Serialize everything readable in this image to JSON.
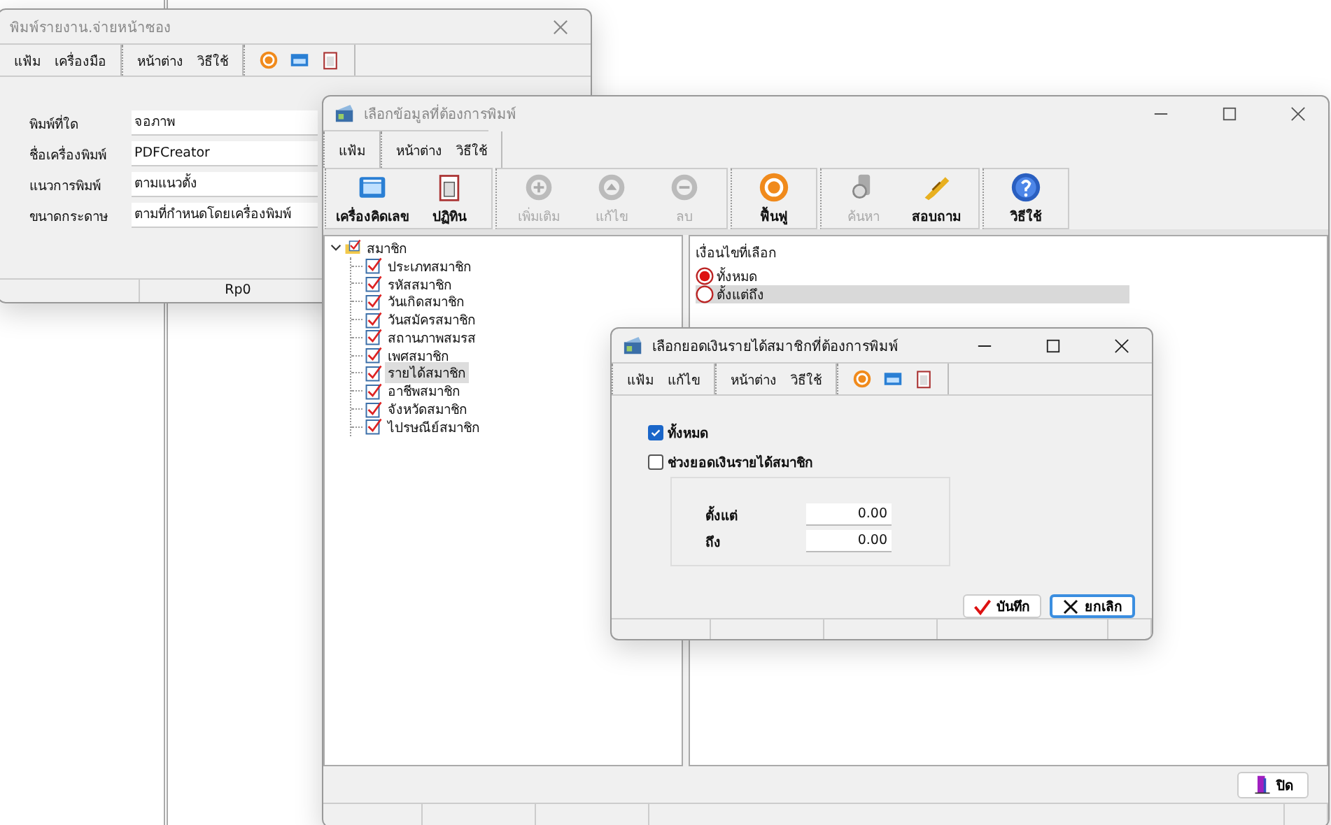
{
  "print_window": {
    "title": "พิมพ์รายงาน.จ่ายหน้าซอง",
    "active": false,
    "menu": [
      [
        "แฟ้ม",
        "เครื่องมือ"
      ],
      [
        "หน้าต่าง",
        "วิธีใช้"
      ]
    ],
    "fields": [
      {
        "label": "พิมพ์ที่ใด",
        "value": "จอภาพ"
      },
      {
        "label": "ชื่อเครื่องพิมพ์",
        "value": "PDFCreator"
      },
      {
        "label": "แนวการพิมพ์",
        "value": "ตามแนวตั้ง"
      },
      {
        "label": "ขนาดกระดาษ",
        "value": "ตามที่กำหนดโดยเครื่องพิมพ์"
      }
    ],
    "status_bar": [
      "Rp0"
    ]
  },
  "select_window": {
    "title": "เลือกข้อมูลที่ต้องการพิมพ์",
    "active": false,
    "menu": [
      [
        "แฟ้ม"
      ],
      [
        "หน้าต่าง",
        "วิธีใช้"
      ]
    ],
    "toolbar": [
      {
        "buttons": [
          {
            "label": "เครื่องคิดเลข",
            "disabled": false
          },
          {
            "label": "ปฏิทิน",
            "disabled": false
          }
        ]
      },
      {
        "buttons": [
          {
            "label": "เพิ่มเติม",
            "disabled": true
          },
          {
            "label": "แก้ไข",
            "disabled": true
          },
          {
            "label": "ลบ",
            "disabled": true
          }
        ]
      },
      {
        "buttons": [
          {
            "label": "ฟื้นฟู",
            "disabled": false
          }
        ]
      },
      {
        "buttons": [
          {
            "label": "ค้นหา",
            "disabled": true
          },
          {
            "label": "สอบถาม",
            "disabled": false
          }
        ]
      },
      {
        "buttons": [
          {
            "label": "วิธีใช้",
            "disabled": false
          }
        ]
      }
    ],
    "tree": {
      "label": "สมาชิก",
      "expanded": true,
      "checked": true,
      "children": [
        {
          "label": "ประเภทสมาชิก",
          "checked": true,
          "selected": false
        },
        {
          "label": "รหัสสมาชิก",
          "checked": true,
          "selected": false
        },
        {
          "label": "วันเกิดสมาชิก",
          "checked": true,
          "selected": false
        },
        {
          "label": "วันสมัครสมาชิก",
          "checked": true,
          "selected": false
        },
        {
          "label": "สถานภาพสมรส",
          "checked": true,
          "selected": false
        },
        {
          "label": "เพศสมาชิก",
          "checked": true,
          "selected": false
        },
        {
          "label": "รายได้สมาชิก",
          "checked": true,
          "selected": true
        },
        {
          "label": "อาชีพสมาชิก",
          "checked": true,
          "selected": false
        },
        {
          "label": "จังหวัดสมาชิก",
          "checked": true,
          "selected": false
        },
        {
          "label": "ไปรษณีย์สมาชิก",
          "checked": true,
          "selected": false
        }
      ]
    },
    "conditions": {
      "heading": "เงื่อนไขที่เลือก",
      "options": [
        {
          "label": "ทั้งหมด",
          "selected": true,
          "highlighted": false
        },
        {
          "label": "ตั้งแต่ถึง",
          "selected": false,
          "highlighted": true
        }
      ]
    },
    "close_button": "ปิด"
  },
  "dialog": {
    "title": "เลือกยอดเงินรายได้สมาชิกที่ต้องการพิมพ์",
    "active": true,
    "menu": [
      [
        "แฟ้ม",
        "แก้ไข"
      ],
      [
        "หน้าต่าง",
        "วิธีใช้"
      ]
    ],
    "options": [
      {
        "label": "ทั้งหมด",
        "checked": true
      },
      {
        "label": "ช่วงยอดเงินรายได้สมาชิก",
        "checked": false
      }
    ],
    "range": [
      {
        "label": "ตั้งแต่",
        "value": "0.00"
      },
      {
        "label": "ถึง",
        "value": "0.00"
      }
    ],
    "buttons": [
      {
        "label": "บันทึก",
        "focused": false
      },
      {
        "label": "ยกเลิก",
        "focused": true
      }
    ]
  }
}
